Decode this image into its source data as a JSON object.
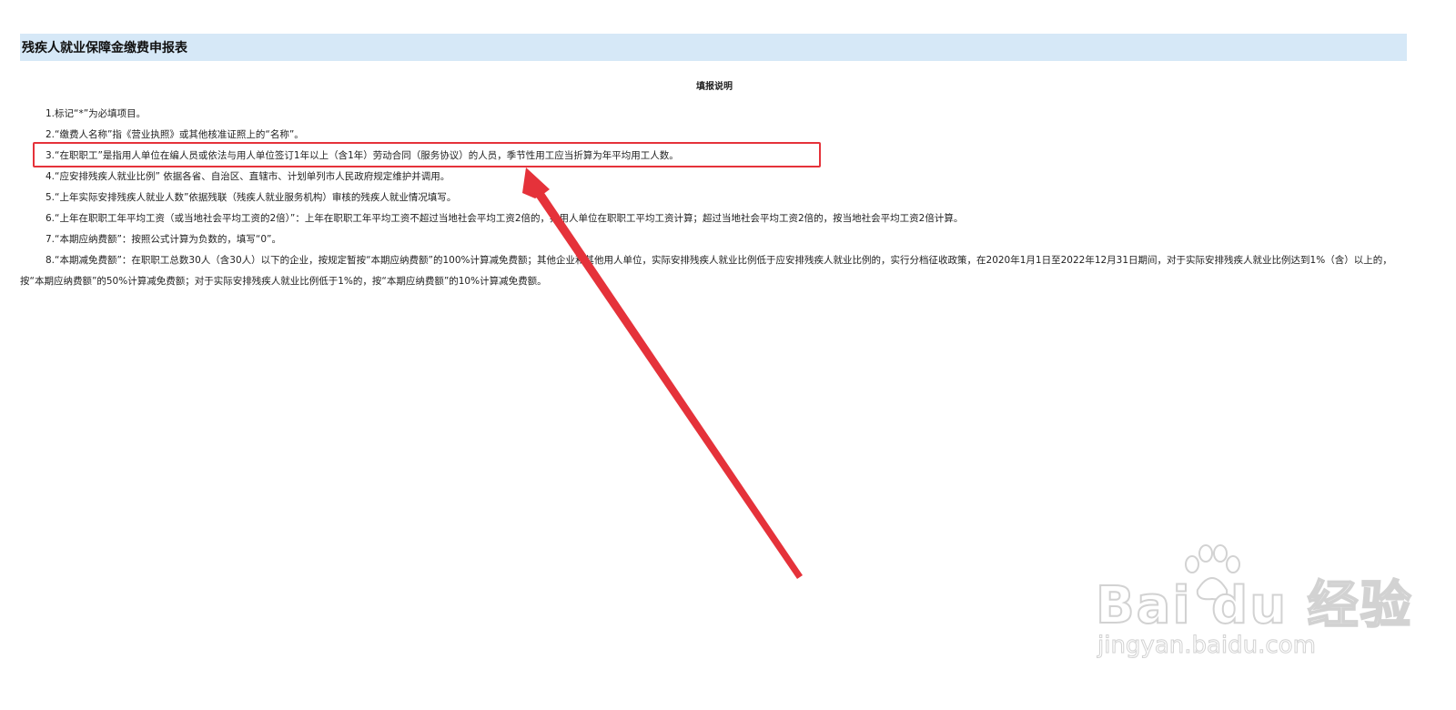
{
  "header": {
    "title": "残疾人就业保障金缴费申报表"
  },
  "instructions": {
    "heading": "填报说明",
    "items": [
      "1.标记“*”为必填项目。",
      "2.“缴费人名称”指《营业执照》或其他核准证照上的“名称”。",
      "3.“在职职工”是指用人单位在编人员或依法与用人单位签订1年以上（含1年）劳动合同（服务协议）的人员，季节性用工应当折算为年平均用工人数。",
      "4.“应安排残疾人就业比例” 依据各省、自治区、直辖市、计划单列市人民政府规定维护并调用。",
      "5.“上年实际安排残疾人就业人数”依据残联（残疾人就业服务机构）审核的残疾人就业情况填写。",
      "6.“上年在职职工年平均工资（或当地社会平均工资的2倍）”：上年在职职工年平均工资不超过当地社会平均工资2倍的，按用人单位在职职工平均工资计算；超过当地社会平均工资2倍的，按当地社会平均工资2倍计算。",
      "7.“本期应纳费额”：按照公式计算为负数的，填写“0”。",
      "8.“本期减免费额”：在职职工总数30人（含30人）以下的企业，按规定暂按“本期应纳费额”的100%计算减免费额；其他企业和其他用人单位，实际安排残疾人就业比例低于应安排残疾人就业比例的，实行分档征收政策，在2020年1月1日至2022年12月31日期间，对于实际安排残疾人就业比例达到1%（含）以上的，按“本期应纳费额”的50%计算减免费额；对于实际安排残疾人就业比例低于1%的，按“本期应纳费额”的10%计算减免费额。"
    ]
  },
  "annotation": {
    "color": "#e5323a"
  },
  "watermark": {
    "brand": "Bai du 经验",
    "url": "jingyan.baidu.com"
  },
  "colors": {
    "title_bg": "#d6e8f7",
    "annotation_red": "#e5323a",
    "watermark_gray": "#d2d2d2"
  }
}
